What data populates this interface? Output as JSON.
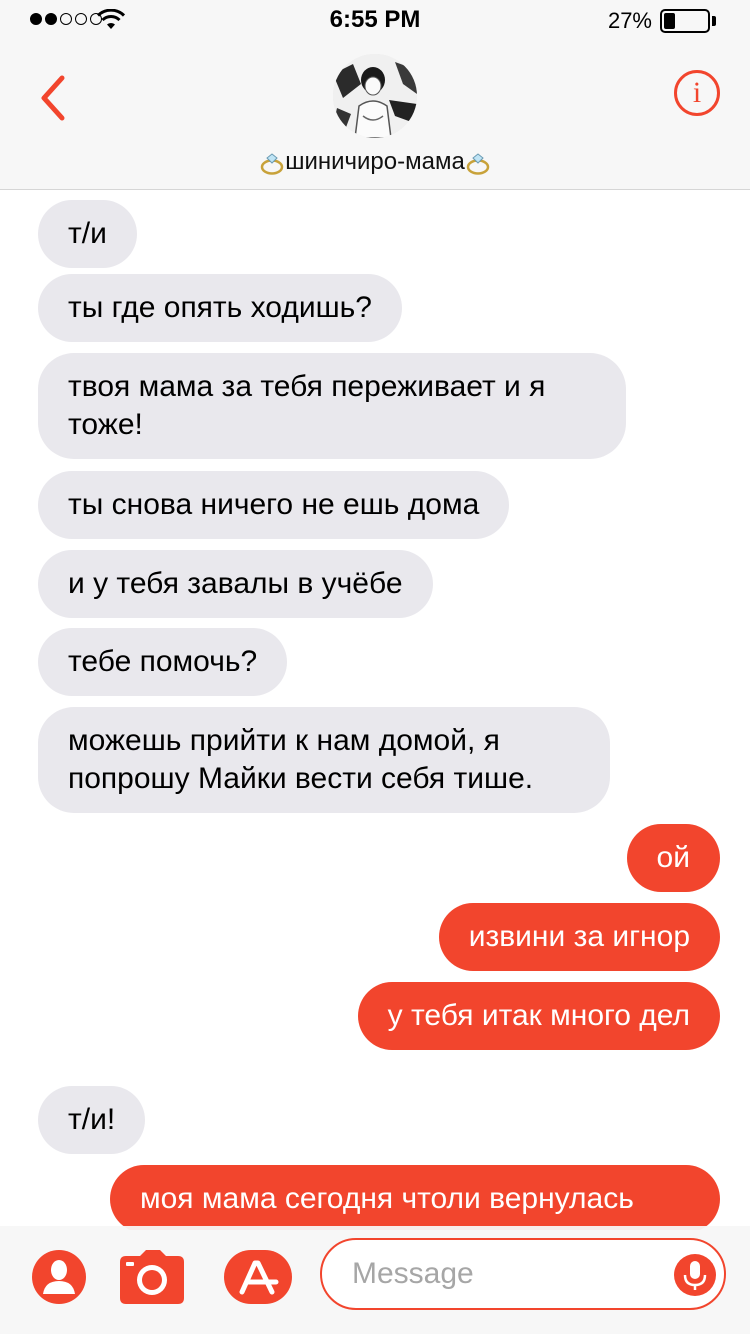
{
  "status_bar": {
    "time": "6:55 PM",
    "battery_percent": "27%",
    "battery_level": 0.27,
    "signal_bars_filled": 2,
    "signal_bars_total": 5
  },
  "header": {
    "contact_name": "шиничиро-мама"
  },
  "messages": [
    {
      "from": "them",
      "text": "т/и"
    },
    {
      "from": "them",
      "text": "ты где опять ходишь?"
    },
    {
      "from": "them",
      "text": "твоя мама за тебя переживает и я тоже!"
    },
    {
      "from": "them",
      "text": "ты снова ничего не ешь дома"
    },
    {
      "from": "them",
      "text": "и у тебя завалы в учёбе"
    },
    {
      "from": "them",
      "text": "тебе помочь?"
    },
    {
      "from": "them",
      "text": "можешь прийти к нам домой, я попрошу Майки вести себя тише."
    },
    {
      "from": "me",
      "text": "ой"
    },
    {
      "from": "me",
      "text": "извини за игнор"
    },
    {
      "from": "me",
      "text": "у тебя итак много дел"
    },
    {
      "from": "them",
      "text": "т/и!"
    },
    {
      "from": "me",
      "text": "моя мама сегодня чтоли вернулась"
    }
  ],
  "input": {
    "placeholder": "Message"
  },
  "colors": {
    "accent": "#f2452d",
    "incoming_bubble": "#e9e8ed",
    "bar_background": "#f7f7f7"
  },
  "icons": [
    "back-chevron-icon",
    "info-icon",
    "contact-icon",
    "camera-icon",
    "app-store-icon",
    "microphone-icon",
    "diamond-ring-icon"
  ]
}
